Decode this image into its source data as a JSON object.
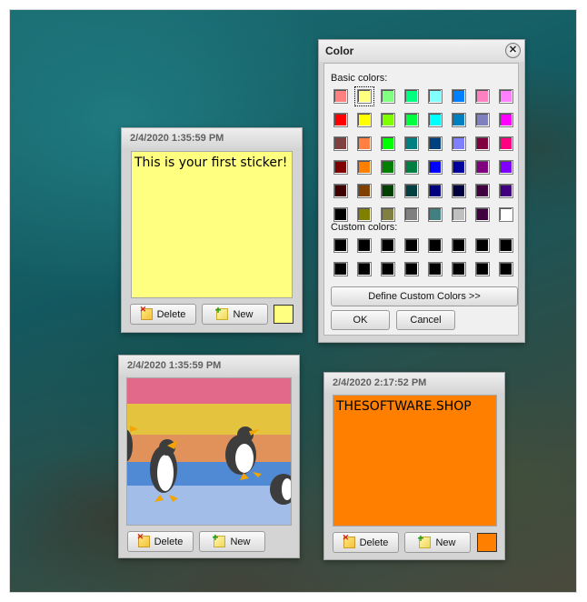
{
  "sticker1": {
    "title": "2/4/2020 1:35:59 PM",
    "text": "This is your first sticker!",
    "note_color": "#ffff80",
    "delete_label": "Delete",
    "new_label": "New"
  },
  "sticker2": {
    "title": "2/4/2020 1:35:59 PM",
    "image_name": "penguins-image",
    "stripe_colors": [
      "#e2698a",
      "#e4c43f",
      "#e0925a",
      "#5089d4",
      "#a2bde8"
    ],
    "delete_label": "Delete",
    "new_label": "New"
  },
  "sticker3": {
    "title": "2/4/2020 2:17:52 PM",
    "text": "THESOFTWARE.SHOP",
    "note_color": "#ff8000",
    "delete_label": "Delete",
    "new_label": "New"
  },
  "color_dialog": {
    "title": "Color",
    "close_icon": "close-icon",
    "basic_label": "Basic colors:",
    "custom_label": "Custom colors:",
    "define_label": "Define Custom Colors >>",
    "ok_label": "OK",
    "cancel_label": "Cancel",
    "selected_basic_index": 1,
    "basic_colors": [
      "#ff8080",
      "#ffff80",
      "#80ff80",
      "#00ff80",
      "#80ffff",
      "#0080ff",
      "#ff80c0",
      "#ff80ff",
      "#ff0000",
      "#ffff00",
      "#80ff00",
      "#00ff40",
      "#00ffff",
      "#0080c0",
      "#8080c0",
      "#ff00ff",
      "#804040",
      "#ff8040",
      "#00ff00",
      "#008080",
      "#004080",
      "#8080ff",
      "#800040",
      "#ff0080",
      "#800000",
      "#ff8000",
      "#008000",
      "#008040",
      "#0000ff",
      "#0000a0",
      "#800080",
      "#8000ff",
      "#400000",
      "#804000",
      "#004000",
      "#004040",
      "#000080",
      "#000040",
      "#400040",
      "#400080",
      "#000000",
      "#808000",
      "#808040",
      "#808080",
      "#408080",
      "#c0c0c0",
      "#400040",
      "#ffffff"
    ],
    "custom_colors": [
      "#000000",
      "#000000",
      "#000000",
      "#000000",
      "#000000",
      "#000000",
      "#000000",
      "#000000",
      "#000000",
      "#000000",
      "#000000",
      "#000000",
      "#000000",
      "#000000",
      "#000000",
      "#000000"
    ]
  }
}
